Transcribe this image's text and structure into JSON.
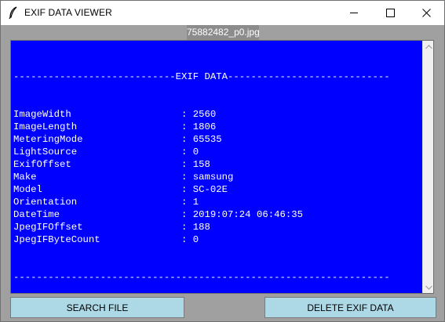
{
  "window": {
    "title": "EXIF DATA VIEWER",
    "app_icon": "feather-icon"
  },
  "file_label": "75882482_p0.jpg",
  "exif": {
    "header": "----------------------------EXIF DATA----------------------------",
    "footer": "-----------------------------------------------------------------",
    "rows": [
      {
        "key": "ImageWidth",
        "value": "2560"
      },
      {
        "key": "ImageLength",
        "value": "1806"
      },
      {
        "key": "MeteringMode",
        "value": "65535"
      },
      {
        "key": "LightSource",
        "value": "0"
      },
      {
        "key": "ExifOffset",
        "value": "158"
      },
      {
        "key": "Make",
        "value": "samsung"
      },
      {
        "key": "Model",
        "value": "SC-02E"
      },
      {
        "key": "Orientation",
        "value": "1"
      },
      {
        "key": "DateTime",
        "value": "2019:07:24 06:46:35"
      },
      {
        "key": "JpegIFOffset",
        "value": "188"
      },
      {
        "key": "JpegIFByteCount",
        "value": "0"
      }
    ]
  },
  "buttons": {
    "search": "SEARCH FILE",
    "delete": "DELETE EXIF DATA"
  },
  "colors": {
    "text_bg": "#0000ff",
    "text_fg": "#ffffff",
    "button_bg": "#add8e6",
    "window_bg": "#a0a0a0"
  }
}
